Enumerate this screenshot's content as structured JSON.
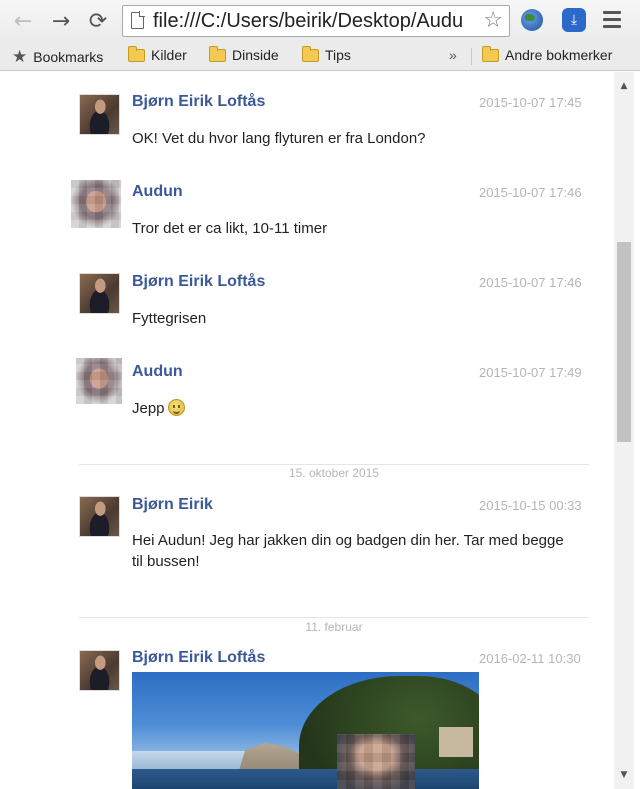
{
  "browser": {
    "url": "file:///C:/Users/beirik/Desktop/Audu",
    "bookmarks": [
      {
        "label": "Bookmarks",
        "icon": "star-icon"
      },
      {
        "label": "Kilder",
        "icon": "folder-icon"
      },
      {
        "label": "Dinside",
        "icon": "folder-icon"
      },
      {
        "label": "Tips",
        "icon": "folder-icon"
      }
    ],
    "bookmarks_overflow": "»",
    "other_bookmarks": "Andre bokmerker"
  },
  "chat": {
    "messages": [
      {
        "sender": "Bjørn Eirik Loftås",
        "time": "2015-10-07 17:45",
        "text": "OK! Vet du hvor lang flyturen er fra London?"
      },
      {
        "sender": "Audun",
        "time": "2015-10-07 17:46",
        "text": "Tror det er ca likt, 10-11 timer"
      },
      {
        "sender": "Bjørn Eirik Loftås",
        "time": "2015-10-07 17:46",
        "text": "Fyttegrisen"
      },
      {
        "sender": "Audun",
        "time": "2015-10-07 17:49",
        "text": "Jepp"
      },
      {
        "sender": "Bjørn Eirik",
        "time": "2015-10-15 00:33",
        "text": "Hei Audun! Jeg har jakken din og badgen din her. Tar med begge til bussen!"
      },
      {
        "sender": "Bjørn Eirik Loftås",
        "time": "2016-02-11 10:30",
        "text": ""
      }
    ],
    "date_separators": [
      "15. oktober 2015",
      "11. februar"
    ]
  }
}
